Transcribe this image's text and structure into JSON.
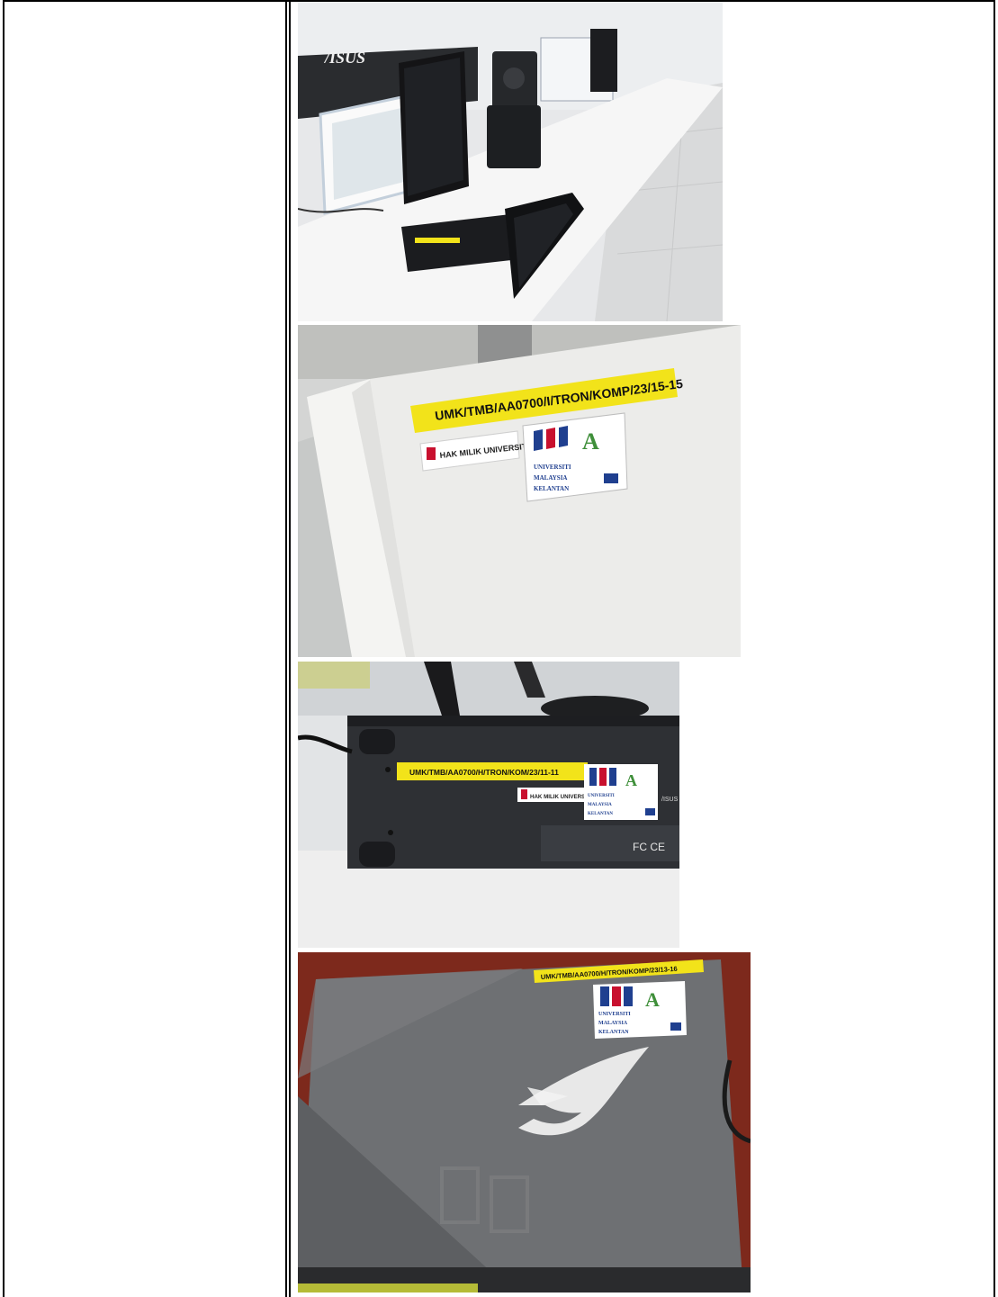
{
  "photos": {
    "desktop_lab": {
      "monitor_brand": "/ISUS"
    },
    "chassis_side": {
      "asset_tag": "UMK/TMB/AA0700/I/TRON/KOMP/23/15-15",
      "ownership_label": "HAK MILIK UNIVERSITI",
      "logo_umk_lines": [
        "UNIVERSITI",
        "MALAYSIA",
        "KELANTAN"
      ],
      "logo_angel": "A"
    },
    "pc_front": {
      "asset_tag": "UMK/TMB/AA0700/H/TRON/KOM/23/11-11",
      "ownership_label": "HAK MILIK UNIVERSITI",
      "logo_umk_lines": [
        "UNIVERSITI",
        "MALAYSIA",
        "KELANTAN"
      ],
      "logo_angel": "A",
      "brand": "/ISUS",
      "cert_marks": "FC CE"
    },
    "laptop_lid": {
      "asset_tag": "UMK/TMB/AA0700/H/TRON/KOMP/23/13-16",
      "logo_umk_lines": [
        "UNIVERSITI",
        "MALAYSIA",
        "KELANTAN"
      ],
      "logo_angel": "A"
    }
  },
  "colors": {
    "tag_yellow": "#f2e31a",
    "umk_red": "#c8102e",
    "umk_blue": "#1f3f8f",
    "angel_green": "#3f8f3a",
    "rog_red": "#8a2a1c"
  }
}
